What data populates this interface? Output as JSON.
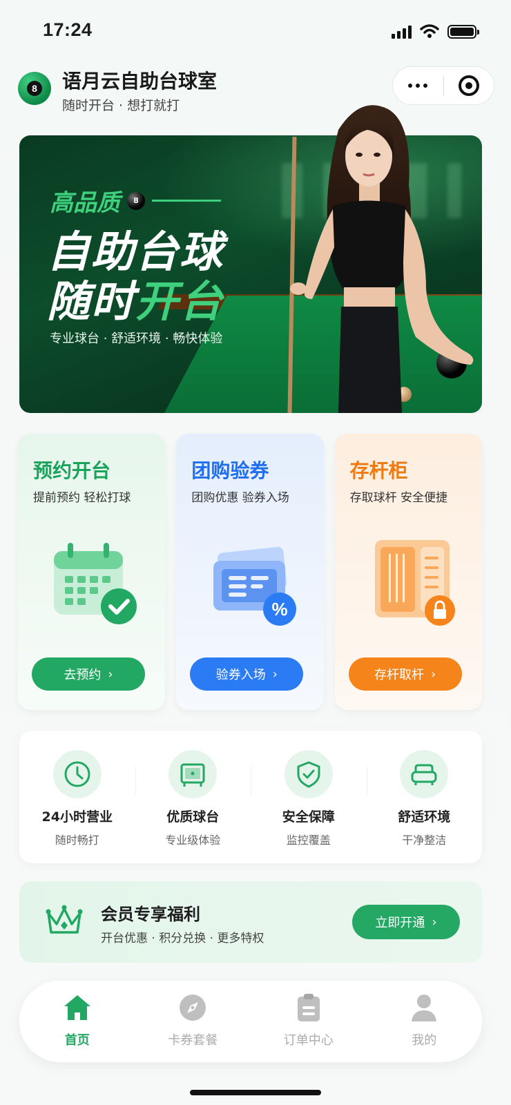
{
  "status_bar": {
    "time": "17:24"
  },
  "header": {
    "logo_number": "8",
    "title": "语月云自助台球室",
    "subtitle": "随时开台 · 想打就打"
  },
  "banner": {
    "kicker": "高品质",
    "kicker_ball": "8",
    "line1": "自助台球",
    "line2_white": "随时",
    "line2_accent": "开台",
    "tagline": "专业球台 · 舒适环境 · 畅快体验"
  },
  "cards": [
    {
      "title": "预约开台",
      "subtitle": "提前预约 轻松打球",
      "button": "去预约",
      "color": "#22a862"
    },
    {
      "title": "团购验券",
      "subtitle": "团购优惠 验券入场",
      "button": "验券入场",
      "color": "#2a7bf4"
    },
    {
      "title": "存杆柜",
      "subtitle": "存取球杆 安全便捷",
      "button": "存杆取杆",
      "color": "#f5841b"
    }
  ],
  "features": [
    {
      "icon": "clock-icon",
      "title": "24小时营业",
      "subtitle": "随时畅打"
    },
    {
      "icon": "table-icon",
      "title": "优质球台",
      "subtitle": "专业级体验"
    },
    {
      "icon": "shield-check-icon",
      "title": "安全保障",
      "subtitle": "监控覆盖"
    },
    {
      "icon": "sofa-icon",
      "title": "舒适环境",
      "subtitle": "干净整洁"
    }
  ],
  "member": {
    "title": "会员专享福利",
    "subtitle": "开台优惠 · 积分兑换 · 更多特权",
    "button": "立即开通"
  },
  "tabbar": [
    {
      "icon": "home-icon",
      "label": "首页",
      "active": true
    },
    {
      "icon": "compass-icon",
      "label": "卡券套餐",
      "active": false
    },
    {
      "icon": "clipboard-icon",
      "label": "订单中心",
      "active": false
    },
    {
      "icon": "user-icon",
      "label": "我的",
      "active": false
    }
  ],
  "colors": {
    "brand_green": "#22a862",
    "blue": "#2a7bf4",
    "orange": "#f5841b"
  }
}
